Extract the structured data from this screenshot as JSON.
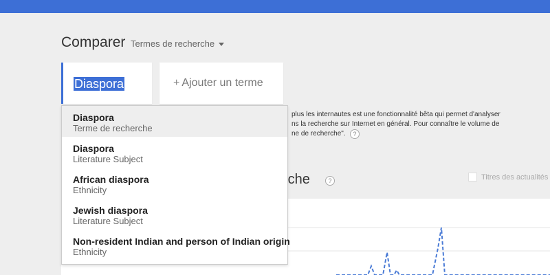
{
  "compare": {
    "title": "Comparer",
    "dropdown_label": "Termes de recherche"
  },
  "term": {
    "value": "Diaspora"
  },
  "add_term": {
    "plus": "+",
    "label": "Ajouter un terme"
  },
  "info": {
    "line1": "plus les internautes est une fonctionnalité bêta qui permet d'analyser",
    "line2": "ns la recherche sur Internet en général. Pour connaître le volume de",
    "line3": "ne de recherche\".",
    "help": "?"
  },
  "section": {
    "title": "rche",
    "help": "?",
    "news_toggle_label": "Titres des actualités"
  },
  "suggestions": [
    {
      "name": "Diaspora",
      "type": "Terme de recherche"
    },
    {
      "name": "Diaspora",
      "type": "Literature Subject"
    },
    {
      "name": "African diaspora",
      "type": "Ethnicity"
    },
    {
      "name": "Jewish diaspora",
      "type": "Literature Subject"
    },
    {
      "name": "Non-resident Indian and person of Indian origin",
      "type": "Ethnicity"
    }
  ],
  "colors": {
    "accent": "#3d6fd6",
    "series": "#4a7bd6"
  }
}
